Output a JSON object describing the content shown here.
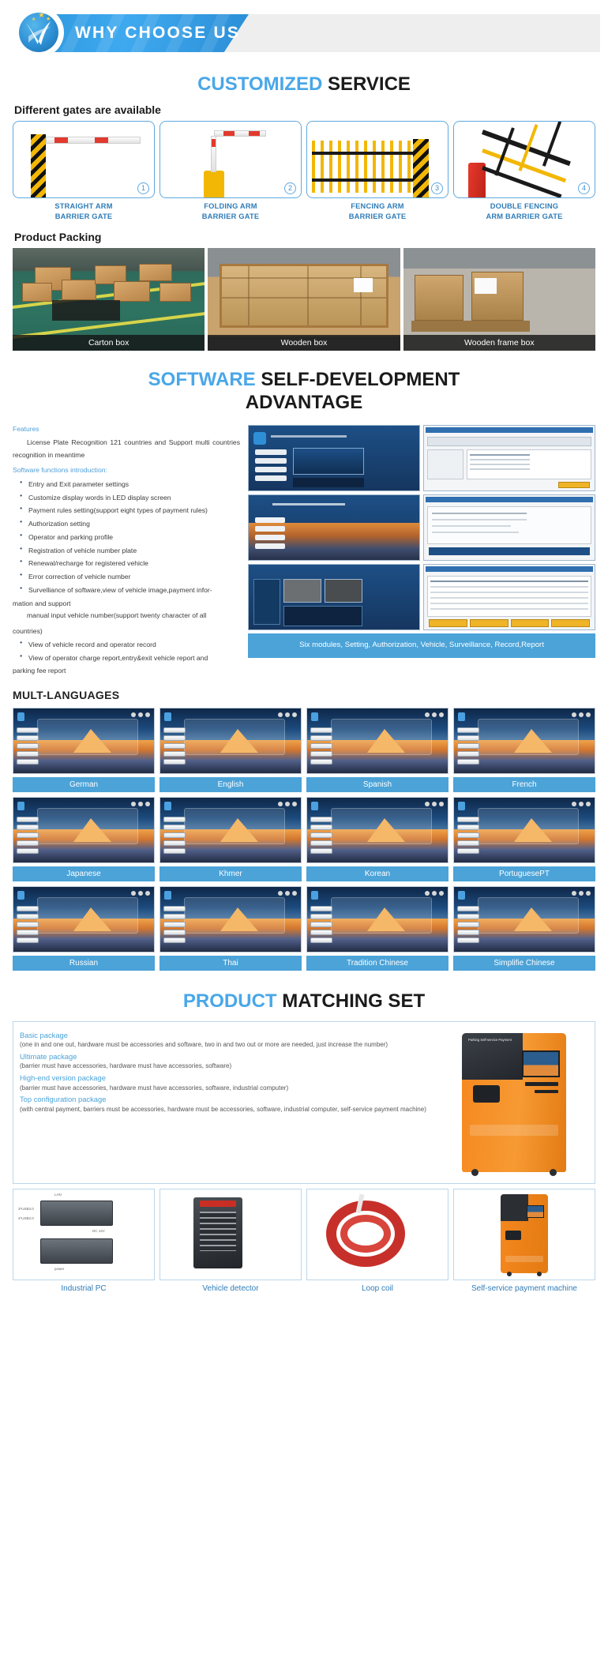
{
  "banner": {
    "title": "WHY CHOOSE US",
    "logo_icon": "company-swoosh-logo-icon"
  },
  "customized_service": {
    "title_highlight": "CUSTOMIZED",
    "title_rest": " SERVICE",
    "subheading": "Different gates are available",
    "gates": [
      {
        "number": "1",
        "caption": "STRAIGHT ARM\nBARRIER GATE",
        "line1": "STRAIGHT ARM",
        "line2": "BARRIER GATE"
      },
      {
        "number": "2",
        "caption": "FOLDING ARM\nBARRIER GATE",
        "line1": "FOLDING ARM",
        "line2": "BARRIER GATE"
      },
      {
        "number": "3",
        "caption": "FENCING ARM\nBARRIER GATE",
        "line1": "FENCING ARM",
        "line2": "BARRIER GATE"
      },
      {
        "number": "4",
        "caption": "DOUBLE FENCING\nARM BARRIER GATE",
        "line1": "DOUBLE FENCING",
        "line2": "ARM BARRIER GATE"
      }
    ]
  },
  "product_packing": {
    "subheading": "Product Packing",
    "items": [
      {
        "caption": "Carton box"
      },
      {
        "caption": "Wooden box"
      },
      {
        "caption": "Wooden frame box"
      }
    ]
  },
  "software": {
    "title_highlight": "SOFTWARE",
    "title_rest": " SELF-DEVELOPMENT",
    "title_line2": "ADVANTAGE",
    "features_label": "Features",
    "intro": "License Plate Recognition 121 countries and Support multi countries recognition in meantime",
    "functions_label": "Software functions introduction:",
    "bullets": [
      "Entry and Exit parameter settings",
      "Customize display words in LED display screen",
      "Payment rules setting(support eight types of  payment rules)",
      "Authorization setting",
      "Operator and parking profile",
      "Registration of vehicle number plate",
      "Renewal/recharge for registered vehicle",
      "Error correction of vehicle number",
      "Survelliance of software,view of vehicle image,payment infor-"
    ],
    "cont1": "mation and support",
    "para2": "manual input vehicle number(support twenty character of all",
    "cont2": "countries)",
    "bullets2": [
      "View of vehicle record and operator record",
      "View of operator charge report,entry&exit vehicle report and"
    ],
    "cont3": "parking fee report",
    "screens_caption": "Six modules, Setting, Authorization, Vehicle, Surveillance, Record,Report"
  },
  "languages": {
    "heading": "MULT-LANGUAGES",
    "items": [
      "German",
      "English",
      "Spanish",
      "French",
      "Japanese",
      "Khmer",
      "Korean",
      "PortuguesePT",
      "Russian",
      "Thai",
      "Tradition Chinese",
      "Simplifie Chinese"
    ]
  },
  "matching_set": {
    "title_highlight": "PRODUCT",
    "title_rest": " MATCHING SET",
    "packages": [
      {
        "name": "Basic package",
        "desc": "(one in and one out, hardware must be accessories and software, two in and two out or more are needed, just increase the number)"
      },
      {
        "name": "Ultimate package",
        "desc": "(barrier must have accessories, hardware must have accessories, software)"
      },
      {
        "name": "High-end version package",
        "desc": "(barrier must have accessories, hardware must have accessories, software, industrial computer)"
      },
      {
        "name": "Top configuration package",
        "desc": "(with central payment, barriers must be accessories, hardware must be accessories, software, industrial computer, self-service payment machine)"
      }
    ],
    "kiosk_header": "Parking Self-service Payment",
    "kiosk_brand": "Parking Self-service Payment",
    "accessories": [
      {
        "caption": "Industrial PC",
        "port_label_1": "3*USB3.0",
        "port_label_2": "4*USB2.0",
        "port_label_3": "LAN",
        "port_label_4": "DC 12V",
        "port_label_5": "power"
      },
      {
        "caption": "Vehicle detector"
      },
      {
        "caption": "Loop coil"
      },
      {
        "caption": "Self-service payment machine"
      }
    ]
  },
  "colors": {
    "accent_blue": "#4ba3d8",
    "title_blue": "#49a7e8",
    "caption_blue": "#2f7cb8",
    "gate_yellow": "#f2b705",
    "kiosk_orange": "#f5881f"
  }
}
